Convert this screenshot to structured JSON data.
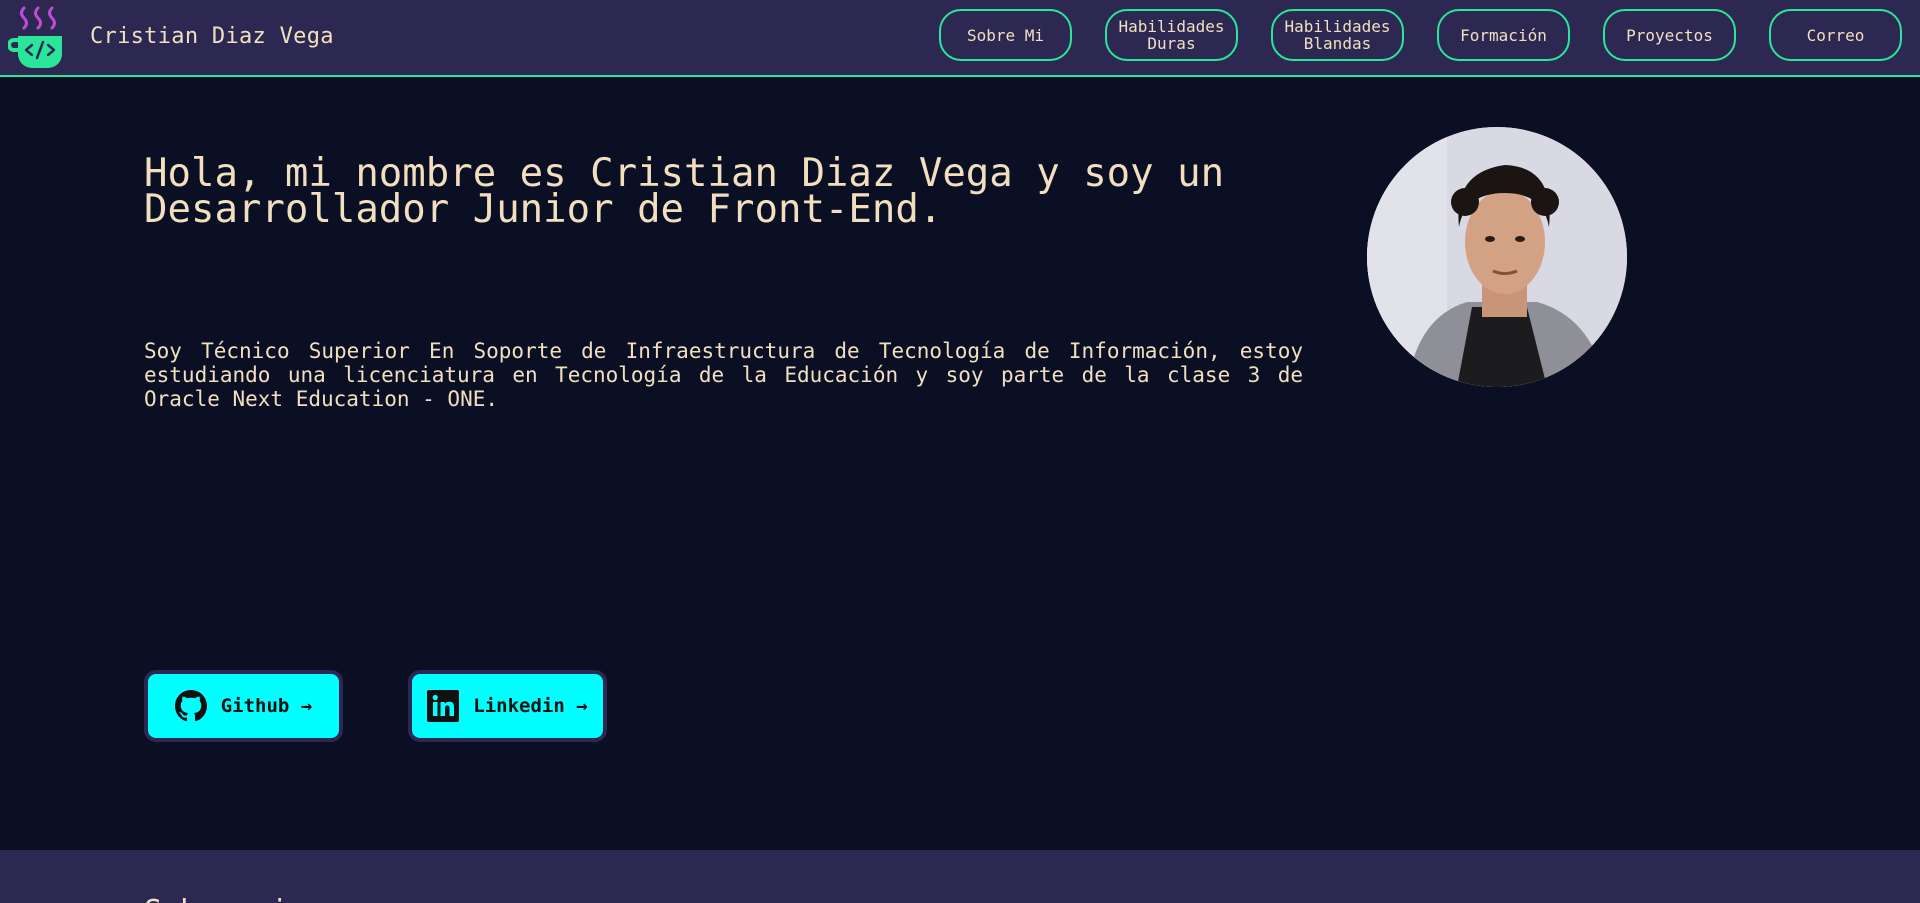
{
  "header": {
    "brand_name": "Cristian Diaz Vega",
    "nav": [
      {
        "label": "Sobre Mi"
      },
      {
        "label": "Habilidades\nDuras"
      },
      {
        "label": "Habilidades\nBlandas"
      },
      {
        "label": "Formación"
      },
      {
        "label": "Proyectos"
      },
      {
        "label": "Correo"
      }
    ]
  },
  "hero": {
    "title": "Hola, mi nombre es Cristian Diaz Vega y soy un Desarrollador Junior de Front-End.",
    "description": "Soy Técnico Superior En Soporte de Infraestructura de Tecnología de Información, estoy estudiando una licenciatura en Tecnología de la Educación y soy parte de la clase 3 de Oracle Next Education - ONE."
  },
  "social": {
    "github_label": "Github →",
    "linkedin_label": "Linkedin →"
  },
  "next_section": {
    "title": "Sobre mi"
  },
  "colors": {
    "background": "#0a0f23",
    "header_bg": "#2c2852",
    "accent_green": "#2ae69a",
    "accent_cyan": "#00ffff",
    "text": "#f1dfc0",
    "logo_steam": "#c04bd6"
  },
  "icons": [
    "coffee-cup-code-logo",
    "github-icon",
    "linkedin-icon"
  ]
}
